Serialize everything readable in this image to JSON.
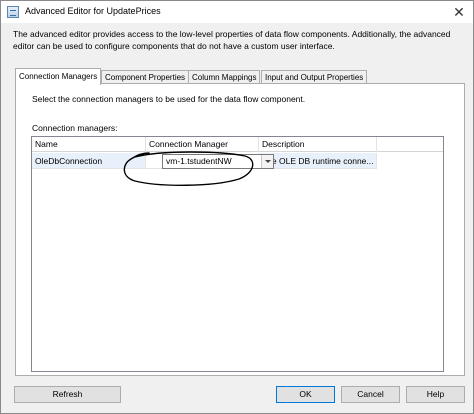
{
  "window": {
    "title": "Advanced Editor for UpdatePrices",
    "close_glyph": "✕"
  },
  "description": "The advanced editor provides access to the low-level properties of data flow components. Additionally, the advanced editor can be used to configure components that do not have a custom user interface.",
  "tabs": [
    {
      "label": "Connection Managers",
      "active": true
    },
    {
      "label": "Component Properties",
      "active": false
    },
    {
      "label": "Column Mappings",
      "active": false
    },
    {
      "label": "Input and Output Properties",
      "active": false
    }
  ],
  "panel": {
    "instruction": "Select the connection managers to be used for the data flow component.",
    "grid_label": "Connection managers:",
    "columns": [
      "Name",
      "Connection Manager",
      "Description"
    ],
    "rows": [
      {
        "name": "OleDbConnection",
        "connection_manager": "vm-1.tstudentNW",
        "description": "The OLE DB runtime conne..."
      }
    ]
  },
  "buttons": {
    "refresh": "Refresh",
    "ok": "OK",
    "cancel": "Cancel",
    "help": "Help"
  },
  "colors": {
    "selected_row": "#e8f0fb",
    "default_button_border": "#0078d7"
  }
}
